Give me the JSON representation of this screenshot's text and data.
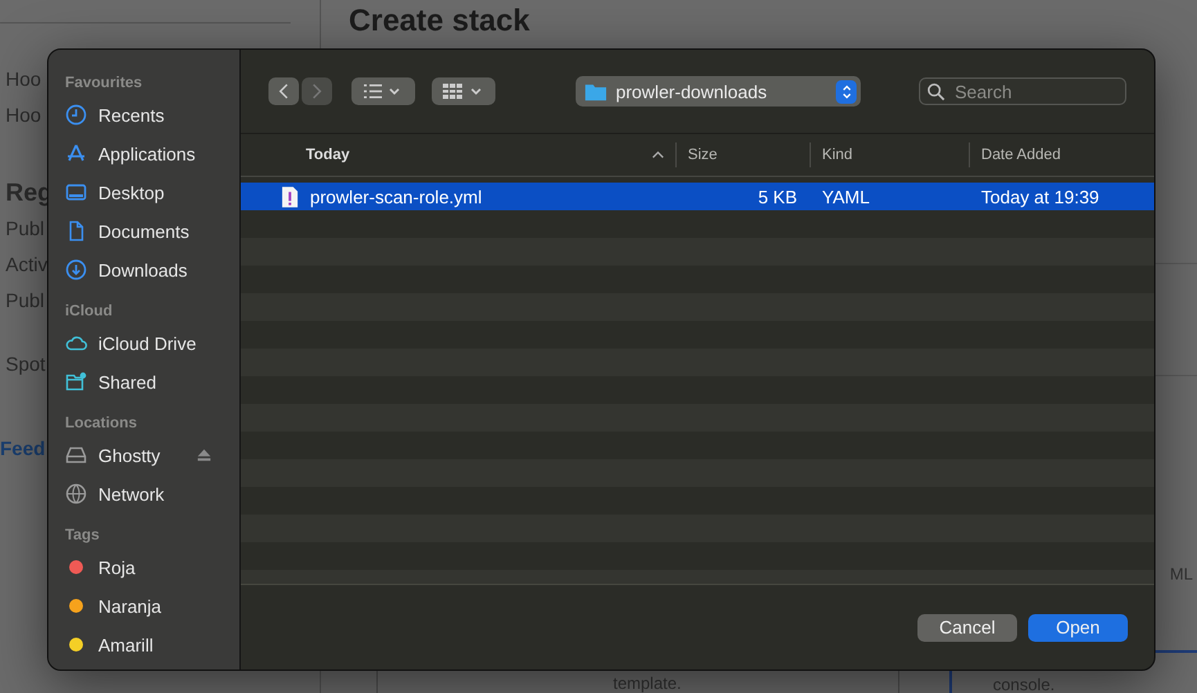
{
  "page": {
    "title": "Create stack",
    "side_items": [
      "Hoo",
      "Hoo",
      "Reg",
      "Publ",
      "Activ",
      "Publ",
      "Spot"
    ],
    "feedback": "Feed",
    "right_fragment": "ML",
    "card_texts": [
      "template.",
      "console."
    ]
  },
  "dialog": {
    "sidebar": [
      {
        "heading": "Favourites",
        "items": [
          {
            "label": "Recents",
            "kind": "clock"
          },
          {
            "label": "Applications",
            "kind": "apps"
          },
          {
            "label": "Desktop",
            "kind": "desktop"
          },
          {
            "label": "Documents",
            "kind": "doc"
          },
          {
            "label": "Downloads",
            "kind": "download"
          }
        ]
      },
      {
        "heading": "iCloud",
        "items": [
          {
            "label": "iCloud Drive",
            "kind": "cloud"
          },
          {
            "label": "Shared",
            "kind": "shared"
          }
        ]
      },
      {
        "heading": "Locations",
        "items": [
          {
            "label": "Ghostty",
            "kind": "disk",
            "eject": true
          },
          {
            "label": "Network",
            "kind": "globe"
          }
        ]
      },
      {
        "heading": "Tags",
        "items": [
          {
            "label": "Roja",
            "kind": "tag",
            "color": "#ef5a55"
          },
          {
            "label": "Naranja",
            "kind": "tag",
            "color": "#f6a21c"
          },
          {
            "label": "Amarill",
            "kind": "tag",
            "color": "#f4cf26"
          }
        ]
      }
    ],
    "location": "prowler-downloads",
    "search": {
      "placeholder": "Search"
    },
    "columns": [
      "Today",
      "Size",
      "Kind",
      "Date Added"
    ],
    "files": [
      {
        "name": "prowler-scan-role.yml",
        "size": "5 KB",
        "kind": "YAML",
        "date": "Today at 19:39",
        "selected": true
      }
    ],
    "buttons": [
      {
        "label": "Cancel",
        "kind": "secondary"
      },
      {
        "label": "Open",
        "kind": "primary"
      }
    ]
  }
}
